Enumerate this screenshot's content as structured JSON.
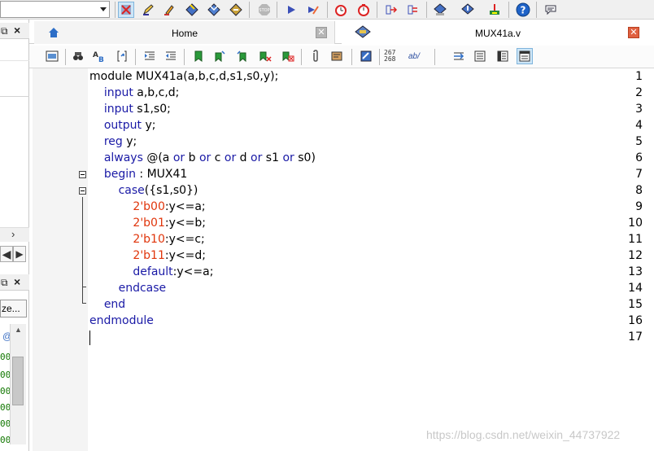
{
  "top_toolbar": {
    "icons": [
      "compile-stop-icon",
      "pencil-icon",
      "highlighter-icon",
      "analysis-icon",
      "synthesis-icon",
      "fitter-icon",
      "stop-icon",
      "run-icon",
      "edit-run-icon",
      "timing-icon",
      "timer-icon",
      "rtl-viewer-icon",
      "netlist-icon",
      "programmer-icon",
      "assembler-icon",
      "chip-planner-icon",
      "help-icon",
      "chat-icon"
    ]
  },
  "left_panel": {
    "button_label": "ze...",
    "code_fragments": [
      "00",
      "00",
      "00",
      "00",
      "00",
      "00"
    ]
  },
  "tabs": [
    {
      "label": "Home",
      "active": false
    },
    {
      "label": "MUX41a.v",
      "active": true
    }
  ],
  "editor_toolbar": {
    "counter_top": "267",
    "counter_bottom": "268",
    "ab_label": "ab/"
  },
  "editor": {
    "line_numbers": [
      "1",
      "2",
      "3",
      "4",
      "5",
      "6",
      "7",
      "8",
      "9",
      "10",
      "11",
      "12",
      "13",
      "14",
      "15",
      "16",
      "17"
    ]
  },
  "watermark": "https://blog.csdn.net/weixin_44737922",
  "colors": {
    "keyword": "#1a1aa6",
    "number": "#e0350b",
    "close_tab": "#e06040"
  }
}
